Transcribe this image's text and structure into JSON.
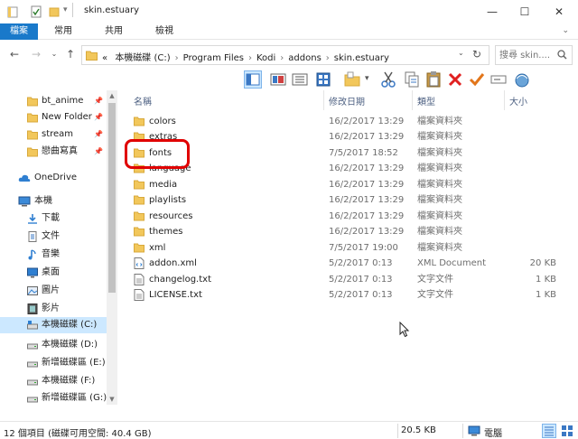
{
  "window": {
    "title": "skin.estuary",
    "controls": {
      "minimize": "—",
      "maximize": "☐",
      "close": "✕"
    }
  },
  "ribbon": {
    "tabs": [
      {
        "label": "檔案",
        "active": true
      },
      {
        "label": "常用",
        "active": false
      },
      {
        "label": "共用",
        "active": false
      },
      {
        "label": "檢視",
        "active": false
      }
    ],
    "collapse_icon": "chevron-down-icon"
  },
  "address": {
    "prefix": "«",
    "crumbs": [
      "本機磁碟 (C:)",
      "Program Files",
      "Kodi",
      "addons",
      "skin.estuary"
    ],
    "separator": "›",
    "search_placeholder": "搜尋 skin...."
  },
  "nav": {
    "items": [
      {
        "label": "bt_anime",
        "icon": "folder-icon",
        "pinned": true
      },
      {
        "label": "New Folder",
        "icon": "folder-icon",
        "pinned": true
      },
      {
        "label": "stream",
        "icon": "folder-icon",
        "pinned": true
      },
      {
        "label": "戀曲寫真",
        "icon": "folder-icon",
        "pinned": true
      },
      {
        "label": "OneDrive",
        "icon": "cloud-icon",
        "pinned": false
      },
      {
        "label": "本機",
        "icon": "computer-icon",
        "pinned": false
      },
      {
        "label": "下載",
        "icon": "download-icon",
        "pinned": false
      },
      {
        "label": "文件",
        "icon": "document-icon",
        "pinned": false
      },
      {
        "label": "音樂",
        "icon": "music-icon",
        "pinned": false
      },
      {
        "label": "桌面",
        "icon": "desktop-icon",
        "pinned": false
      },
      {
        "label": "圖片",
        "icon": "pictures-icon",
        "pinned": false
      },
      {
        "label": "影片",
        "icon": "video-icon",
        "pinned": false
      },
      {
        "label": "本機磁碟 (C:)",
        "icon": "drive-icon",
        "pinned": false,
        "selected": true
      },
      {
        "label": "本機磁碟 (D:)",
        "icon": "drive-icon",
        "pinned": false
      },
      {
        "label": "新增磁碟區 (E:)",
        "icon": "drive-icon",
        "pinned": false
      },
      {
        "label": "本機磁碟 (F:)",
        "icon": "drive-icon",
        "pinned": false
      },
      {
        "label": "新增磁碟區 (G:)",
        "icon": "drive-icon",
        "pinned": false
      }
    ]
  },
  "columns": {
    "name": "名稱",
    "date": "修改日期",
    "type": "類型",
    "size": "大小"
  },
  "files": [
    {
      "name": "colors",
      "date": "16/2/2017 13:29",
      "type": "檔案資料夾",
      "size": "",
      "kind": "folder"
    },
    {
      "name": "extras",
      "date": "16/2/2017 13:29",
      "type": "檔案資料夾",
      "size": "",
      "kind": "folder"
    },
    {
      "name": "fonts",
      "date": "7/5/2017 18:52",
      "type": "檔案資料夾",
      "size": "",
      "kind": "folder"
    },
    {
      "name": "language",
      "date": "16/2/2017 13:29",
      "type": "檔案資料夾",
      "size": "",
      "kind": "folder"
    },
    {
      "name": "media",
      "date": "16/2/2017 13:29",
      "type": "檔案資料夾",
      "size": "",
      "kind": "folder"
    },
    {
      "name": "playlists",
      "date": "16/2/2017 13:29",
      "type": "檔案資料夾",
      "size": "",
      "kind": "folder"
    },
    {
      "name": "resources",
      "date": "16/2/2017 13:29",
      "type": "檔案資料夾",
      "size": "",
      "kind": "folder"
    },
    {
      "name": "themes",
      "date": "16/2/2017 13:29",
      "type": "檔案資料夾",
      "size": "",
      "kind": "folder"
    },
    {
      "name": "xml",
      "date": "7/5/2017 19:00",
      "type": "檔案資料夾",
      "size": "",
      "kind": "folder"
    },
    {
      "name": "addon.xml",
      "date": "5/2/2017 0:13",
      "type": "XML Document",
      "size": "20 KB",
      "kind": "xml"
    },
    {
      "name": "changelog.txt",
      "date": "5/2/2017 0:13",
      "type": "文字文件",
      "size": "1 KB",
      "kind": "txt"
    },
    {
      "name": "LICENSE.txt",
      "date": "5/2/2017 0:13",
      "type": "文字文件",
      "size": "1 KB",
      "kind": "txt"
    }
  ],
  "status": {
    "items_text": "12 個項目 (磁碟可用空間: 40.4 GB)",
    "size_text": "20.5 KB",
    "location_text": "電腦"
  },
  "colors": {
    "accent": "#1979ca",
    "folder": "#f2c75b",
    "highlight": "#e00000",
    "selected": "#cce8ff"
  }
}
